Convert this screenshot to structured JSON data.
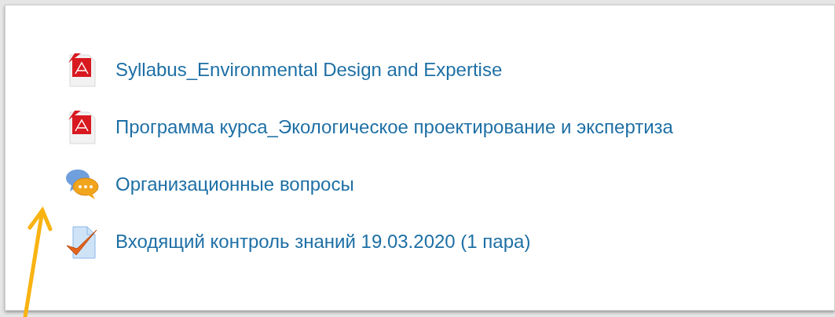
{
  "activities": [
    {
      "kind": "pdf",
      "label": "Syllabus_Environmental Design and Expertise"
    },
    {
      "kind": "pdf",
      "label": "Программа курса_Экологическое проектирование и экспертиза"
    },
    {
      "kind": "forum",
      "label": "Организационные вопросы"
    },
    {
      "kind": "quiz",
      "label": "Входящий контроль знаний 19.03.2020 (1 пара)"
    }
  ]
}
